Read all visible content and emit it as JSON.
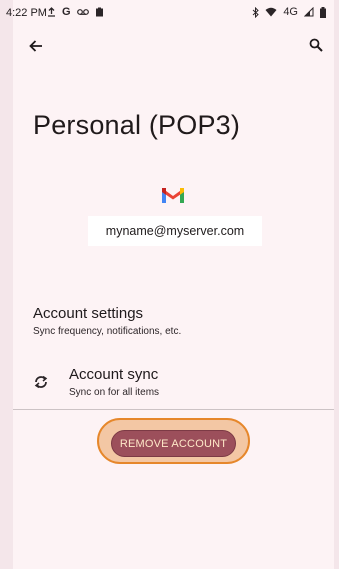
{
  "status_bar": {
    "time": "4:22 PM",
    "left_icons": [
      "upload-icon",
      "google-icon",
      "voicemail-icon",
      "clipboard-icon"
    ],
    "network": "4G",
    "right_icons": [
      "bluetooth-icon",
      "wifi-icon",
      "signal-icon",
      "battery-icon"
    ]
  },
  "toolbar": {
    "back_icon": "arrow-left-icon",
    "search_icon": "search-icon"
  },
  "account": {
    "title": "Personal (POP3)",
    "logo": "gmail-logo",
    "email": "myname@myserver.com"
  },
  "settings": {
    "title": "Account settings",
    "subtitle": "Sync frequency, notifications, etc."
  },
  "sync": {
    "icon": "sync-icon",
    "title": "Account sync",
    "subtitle": "Sync on for all items"
  },
  "actions": {
    "remove_label": "REMOVE ACCOUNT"
  },
  "colors": {
    "background": "#fdf3f5",
    "remove_button": "#9c4f5b",
    "highlight_ring": "#e6872b"
  }
}
